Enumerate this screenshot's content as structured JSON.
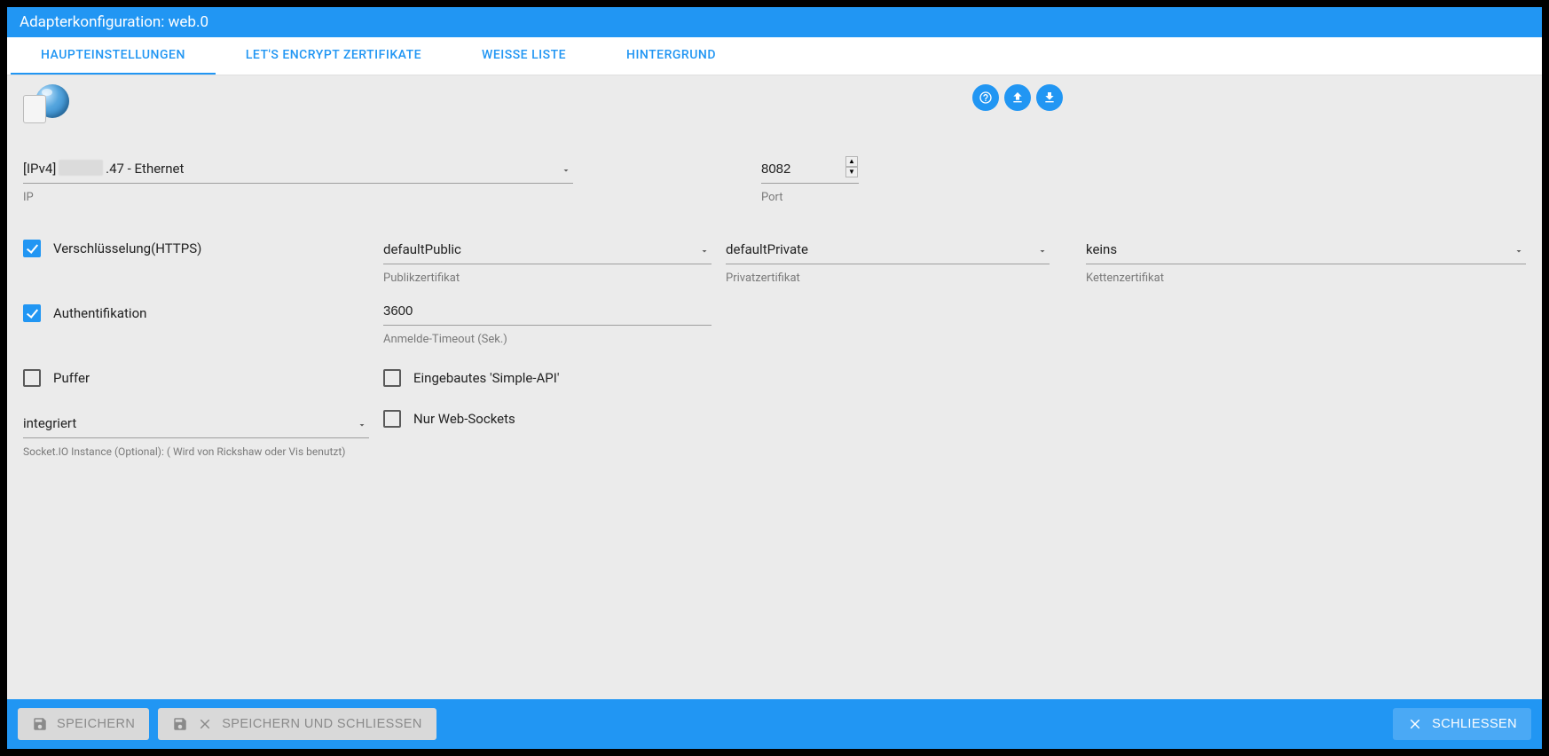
{
  "title": "Adapterkonfiguration: web.0",
  "tabs": [
    "HAUPTEINSTELLUNGEN",
    "LET'S ENCRYPT ZERTIFIKATE",
    "WEISSE LISTE",
    "HINTERGRUND"
  ],
  "activeTab": 0,
  "ip": {
    "value_prefix": "[IPv4] ",
    "value_suffix": ".47 - Ethernet",
    "helper": "IP"
  },
  "port": {
    "value": "8082",
    "helper": "Port"
  },
  "https": {
    "label": "Verschlüsselung(HTTPS)",
    "checked": true
  },
  "publicCert": {
    "value": "defaultPublic",
    "helper": "Publikzertifikat"
  },
  "privateCert": {
    "value": "defaultPrivate",
    "helper": "Privatzertifikat"
  },
  "chainCert": {
    "value": "keins",
    "helper": "Kettenzertifikat"
  },
  "auth": {
    "label": "Authentifikation",
    "checked": true
  },
  "loginTimeout": {
    "value": "3600",
    "helper": "Anmelde-Timeout (Sek.)"
  },
  "buffer": {
    "label": "Puffer",
    "checked": false
  },
  "simpleApi": {
    "label": "Eingebautes 'Simple-API'",
    "checked": false
  },
  "webSocketsOnly": {
    "label": "Nur Web-Sockets",
    "checked": false
  },
  "socketio": {
    "value": "integriert",
    "helper": "Socket.IO Instance (Optional): (      Wird von Rickshaw oder Vis benutzt)"
  },
  "footer": {
    "save": "SPEICHERN",
    "saveClose": "SPEICHERN UND SCHLIESSEN",
    "close": "SCHLIESSEN"
  }
}
